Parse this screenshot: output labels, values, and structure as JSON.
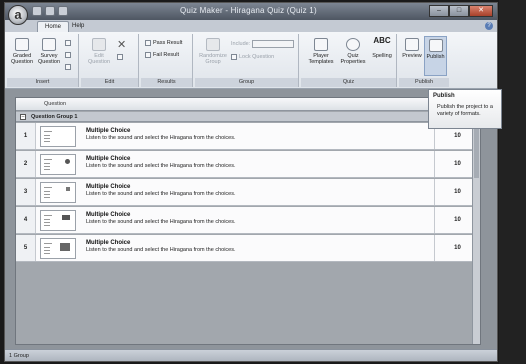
{
  "window": {
    "title": "Quiz Maker - Hiragana Quiz (Quiz 1)"
  },
  "app_button": {
    "glyph": "a"
  },
  "window_controls": {
    "minimize": "–",
    "maximize": "□",
    "close": "✕"
  },
  "tabs": [
    {
      "label": "Home"
    },
    {
      "label": "Help"
    }
  ],
  "help_glyph": "?",
  "ribbon": {
    "insert": {
      "label": "Insert",
      "graded": "Graded Question",
      "survey": "Survey Question"
    },
    "edit": {
      "label": "Edit",
      "edit_question": "Edit Question",
      "delete": "✕"
    },
    "results": {
      "label": "Results",
      "pass": "Pass Result",
      "fail": "Fail Result"
    },
    "group": {
      "label": "Group",
      "randomize": "Randomize Group",
      "include": "Include:",
      "lock": "Lock Question"
    },
    "quiz": {
      "label": "Quiz",
      "player_templates": "Player Templates",
      "quiz_properties": "Quiz Properties",
      "spelling": "Spelling",
      "spelling_glyph": "ABC"
    },
    "publish": {
      "label": "Publish",
      "preview": "Preview",
      "publish": "Publish"
    }
  },
  "tooltip": {
    "title": "Publish",
    "body": "Publish the project to a variety of formats."
  },
  "grid": {
    "column_question": "Question",
    "group_toggle": "–",
    "group_name": "Question Group 1",
    "rows": [
      {
        "num": "1",
        "type": "Multiple Choice",
        "desc": "Listen to the sound and select the Hiragana from the choices.",
        "score": "10"
      },
      {
        "num": "2",
        "type": "Multiple Choice",
        "desc": "Listen to the sound and select the Hiragana from the choices.",
        "score": "10"
      },
      {
        "num": "3",
        "type": "Multiple Choice",
        "desc": "Listen to the sound and select the Hiragana from the choices.",
        "score": "10"
      },
      {
        "num": "4",
        "type": "Multiple Choice",
        "desc": "Listen to the sound and select the Hiragana from the choices.",
        "score": "10"
      },
      {
        "num": "5",
        "type": "Multiple Choice",
        "desc": "Listen to the sound and select the Hiragana from the choices.",
        "score": "10"
      }
    ]
  },
  "statusbar": {
    "text": "1 Group"
  },
  "colors": {
    "ribbon_bg": "#e8ecf1",
    "grid_bg": "#a2a7ad",
    "window_frame": "#4e5662"
  }
}
